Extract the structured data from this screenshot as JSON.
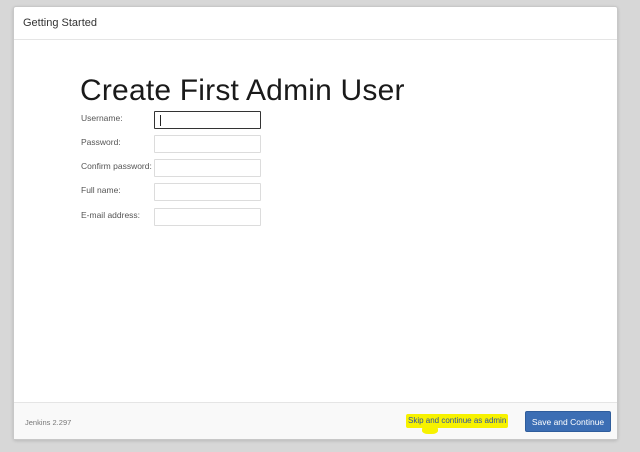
{
  "header": {
    "title": "Getting Started"
  },
  "main": {
    "title": "Create First Admin User",
    "fields": [
      {
        "label": "Username:",
        "value": "",
        "placeholder": ""
      },
      {
        "label": "Password:",
        "value": "",
        "placeholder": ""
      },
      {
        "label": "Confirm password:",
        "value": "",
        "placeholder": ""
      },
      {
        "label": "Full name:",
        "value": "",
        "placeholder": ""
      },
      {
        "label": "E-mail address:",
        "value": "",
        "placeholder": ""
      }
    ]
  },
  "footer": {
    "version": "Jenkins 2.297",
    "skip_label": "Skip and continue as admin",
    "save_label": "Save and Continue"
  },
  "colors": {
    "primary_button": "#3c6eb4",
    "highlight": "#f7f200",
    "link": "#2c4fa6"
  }
}
